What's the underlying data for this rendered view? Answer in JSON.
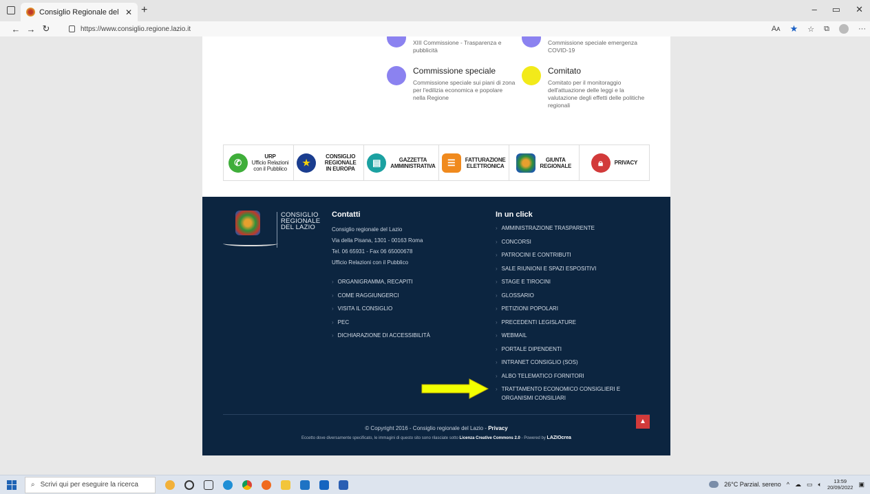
{
  "browser": {
    "tab_title": "Consiglio Regionale del Lazio - ",
    "url": "https://www.consiglio.regione.lazio.it",
    "reader_label": "Aᴀ"
  },
  "commissions": [
    {
      "title": "",
      "desc": "XIII Commissione - Trasparenza e pubblicità",
      "color": "#8b82f0"
    },
    {
      "title": "",
      "desc": "Commissione speciale emergenza COVID-19",
      "color": "#8b82f0"
    },
    {
      "title": "Commissione speciale",
      "desc": "Commissione speciale sui piani di zona per l'edilizia economica e popolare nella Regione",
      "color": "#8b82f0"
    },
    {
      "title": "Comitato",
      "desc": "Comitato per il monitoraggio dell'attuazione delle leggi e la valutazione degli effetti delle politiche regionali",
      "color": "#f2ea1a"
    }
  ],
  "banners": [
    {
      "label_1": "URP",
      "label_2": "Ufficio Relazioni",
      "label_3": "con il Pubblico",
      "color": "#3fae3a",
      "glyph": "✆"
    },
    {
      "label_1": "CONSIGLIO REGIONALE",
      "label_2": "IN EUROPA",
      "label_3": "",
      "color": "#1a3d8f",
      "glyph": "★"
    },
    {
      "label_1": "GAZZETTA",
      "label_2": "AMMINISTRATIVA",
      "label_3": "",
      "color": "#1ba1a1",
      "glyph": "▤"
    },
    {
      "label_1": "FATTURAZIONE",
      "label_2": "ELETTRONICA",
      "label_3": "",
      "color": "#f08a1e",
      "glyph": "☰"
    },
    {
      "label_1": "GIUNTA",
      "label_2": "REGIONALE",
      "label_3": "",
      "color": "#2e7bc4",
      "glyph": "✦"
    },
    {
      "label_1": "PRIVACY",
      "label_2": "",
      "label_3": "",
      "color": "#d23a3a",
      "glyph": "⌂"
    }
  ],
  "footer": {
    "logo_line_1": "CONSIGLIO",
    "logo_line_2": "REGIONALE",
    "logo_line_3": "DEL LAZIO",
    "contatti": {
      "title": "Contatti",
      "lines": [
        "Consiglio regionale del Lazio",
        "Via della Pisana, 1301 - 00163 Roma",
        "Tel. 06 65931 - Fax 06 65000678",
        "Ufficio Relazioni con il Pubblico"
      ],
      "links": [
        "ORGANIGRAMMA, RECAPITI",
        "COME RAGGIUNGERCI",
        "VISITA IL CONSIGLIO",
        "PEC",
        "DICHIARAZIONE DI ACCESSIBILITÀ"
      ]
    },
    "in_un_click": {
      "title": "In un click",
      "links": [
        "AMMINISTRAZIONE TRASPARENTE",
        "CONCORSI",
        "PATROCINI E CONTRIBUTI",
        "SALE RIUNIONI E SPAZI ESPOSITIVI",
        "STAGE E TIROCINI",
        "GLOSSARIO",
        "PETIZIONI POPOLARI",
        "PRECEDENTI LEGISLATURE",
        "WEBMAIL",
        "PORTALE DIPENDENTI",
        "INTRANET CONSIGLIO (SOS)",
        "ALBO TELEMATICO FORNITORI",
        "TRATTAMENTO ECONOMICO CONSIGLIERI E ORGANISMI CONSILIARI"
      ]
    },
    "copyright_text": "© Copyright 2016 - Consiglio regionale del Lazio - ",
    "copyright_link": "Privacy",
    "license_text": "Eccetto dove diversamente specificato, le immagini di questo sito sono rilasciate sotto ",
    "license_link": "Licenza Creative Commons 2.0",
    "powered_text": " - Powered by ",
    "powered_brand": "LAZIOcrea"
  },
  "taskbar": {
    "search_placeholder": "Scrivi qui per eseguire la ricerca",
    "weather": "26°C Parzial. sereno",
    "time": "13:59",
    "date": "20/09/2022"
  },
  "colors": {
    "footer_bg": "#0c2540",
    "arrow": "#f2ff00",
    "accent_red": "#d23a3a"
  }
}
